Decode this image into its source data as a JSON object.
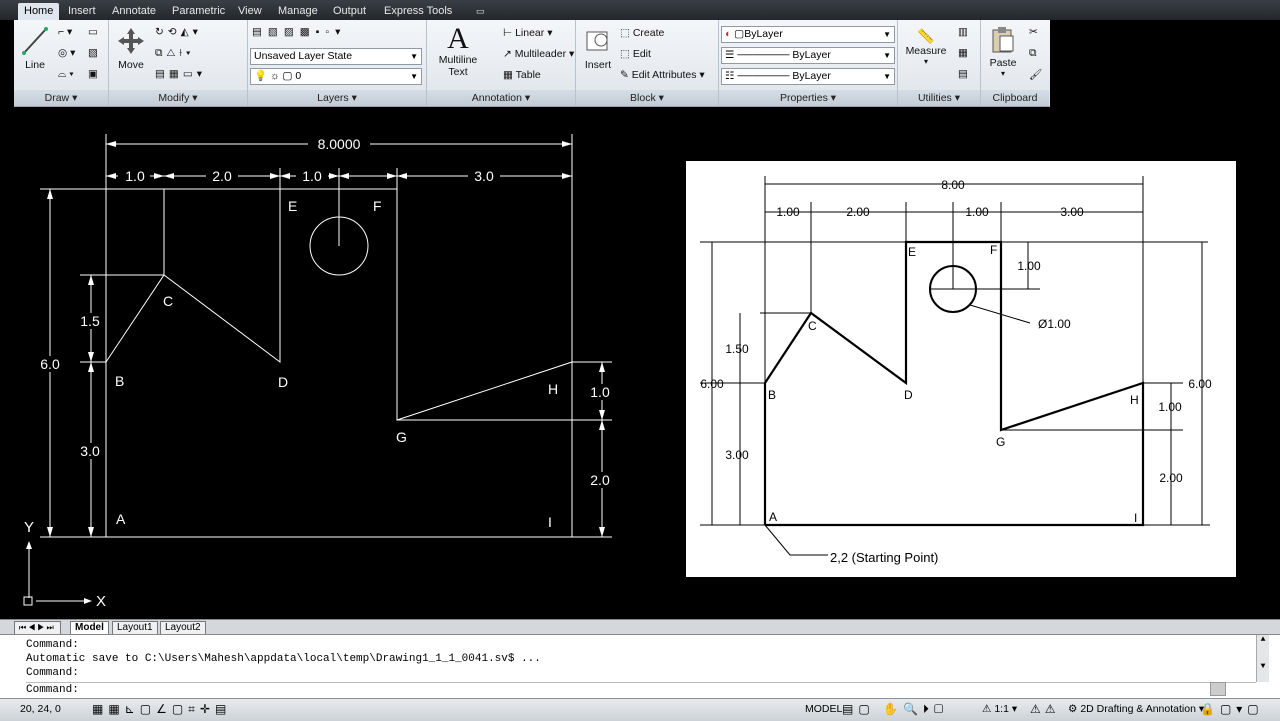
{
  "ribbon_tabs": [
    "Home",
    "Insert",
    "Annotate",
    "Parametric",
    "View",
    "Manage",
    "Output",
    "Express Tools"
  ],
  "panels": {
    "draw": {
      "label": "Draw",
      "line": "Line"
    },
    "modify": {
      "label": "Modify",
      "move": "Move"
    },
    "layers": {
      "label": "Layers",
      "layer_state": "Unsaved Layer State",
      "current_layer": "0"
    },
    "annotation": {
      "label": "Annotation",
      "multiline_text": "Multiline",
      "multiline_text2": "Text",
      "linear": "Linear",
      "multileader": "Multileader",
      "table": "Table"
    },
    "block": {
      "label": "Block",
      "insert": "Insert",
      "create": "Create",
      "edit": "Edit",
      "edit_attributes": "Edit Attributes"
    },
    "properties": {
      "label": "Properties",
      "color": "ByLayer",
      "linetype": "ByLayer",
      "lineweight": "ByLayer"
    },
    "utilities": {
      "label": "Utilities",
      "measure": "Measure"
    },
    "clipboard": {
      "label": "Clipboard",
      "paste": "Paste"
    }
  },
  "drawing": {
    "dims": {
      "overall": "8.0000",
      "d1": "1.0",
      "d2": "2.0",
      "d3": "1.0",
      "d4": "3.0",
      "left_total": "6.0",
      "left_c": "1.5",
      "left_b": "3.0",
      "right_h": "1.0",
      "right_g": "2.0"
    },
    "points": {
      "A": "A",
      "B": "B",
      "C": "C",
      "D": "D",
      "E": "E",
      "F": "F",
      "G": "G",
      "H": "H",
      "I": "I"
    },
    "axis_x": "X",
    "axis_y": "Y"
  },
  "reference": {
    "dims": {
      "overall": "8.00",
      "d1": "1.00",
      "d2": "2.00",
      "d3": "1.00",
      "d4": "3.00",
      "hole_off": "1.00",
      "diameter": "Ø1.00",
      "left_c": "1.50",
      "left_total": "6.00",
      "left_b": "3.00",
      "right_total": "6.00",
      "right_h": "1.00",
      "right_g": "2.00"
    },
    "points": {
      "A": "A",
      "B": "B",
      "C": "C",
      "D": "D",
      "E": "E",
      "F": "F",
      "G": "G",
      "H": "H",
      "I": "I"
    },
    "start_note": "2,2 (Starting Point)"
  },
  "layout_tabs": [
    "Model",
    "Layout1",
    "Layout2"
  ],
  "command_lines": [
    "Command:",
    "Automatic save to C:\\Users\\Mahesh\\appdata\\local\\temp\\Drawing1_1_1_0041.sv$ ...",
    "Command:",
    "Command:"
  ],
  "status": {
    "coords": "20, 24, 0",
    "model": "MODEL",
    "scale": "1:1",
    "workspace": "2D Drafting & Annotation"
  }
}
